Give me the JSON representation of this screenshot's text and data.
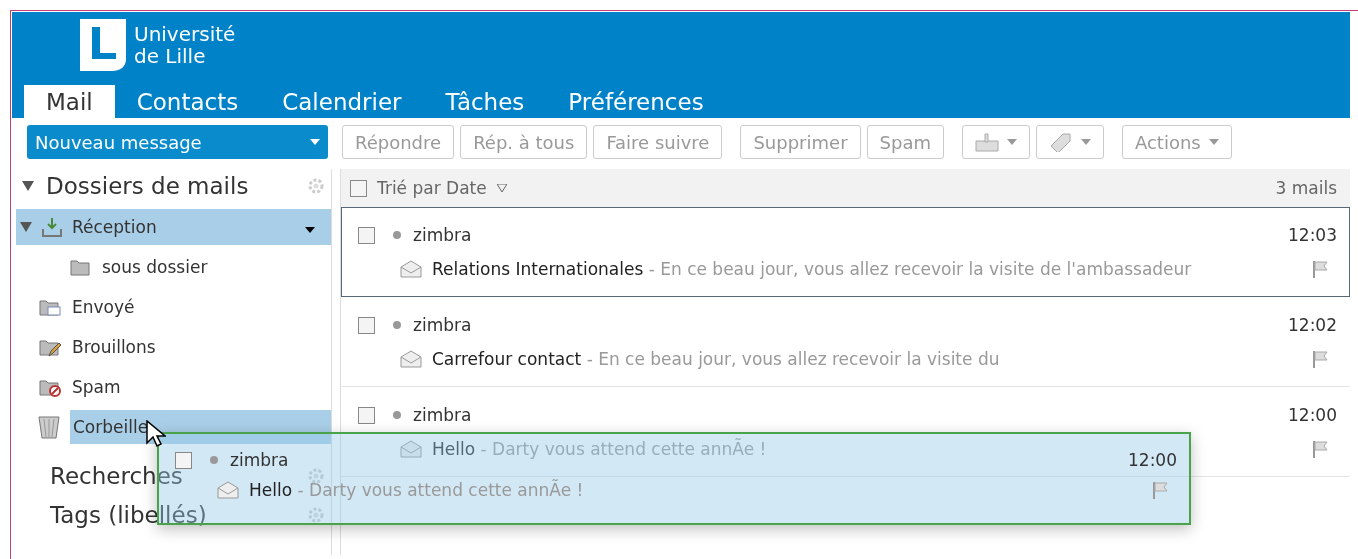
{
  "header": {
    "logo_lines": [
      "Université",
      "de Lille"
    ]
  },
  "tabs": [
    {
      "label": "Mail",
      "selected": true
    },
    {
      "label": "Contacts",
      "selected": false
    },
    {
      "label": "Calendrier",
      "selected": false
    },
    {
      "label": "Tâches",
      "selected": false
    },
    {
      "label": "Préférences",
      "selected": false
    }
  ],
  "new_message": {
    "label": "Nouveau message"
  },
  "toolbar": [
    {
      "kind": "text",
      "label": "Répondre",
      "disabled": true
    },
    {
      "kind": "text",
      "label": "Rép. à tous",
      "disabled": true
    },
    {
      "kind": "text",
      "label": "Faire suivre",
      "disabled": true
    },
    {
      "kind": "text",
      "label": "Supprimer",
      "disabled": true
    },
    {
      "kind": "text",
      "label": "Spam",
      "disabled": true
    },
    {
      "kind": "move",
      "disabled": true
    },
    {
      "kind": "tag",
      "disabled": true
    },
    {
      "kind": "menu",
      "label": "Actions",
      "disabled": true
    }
  ],
  "sidebar": {
    "title": "Dossiers de mails",
    "expanded": true,
    "folders": [
      {
        "kind": "inbox",
        "label": "Réception",
        "selected": true,
        "drop_target": false,
        "expanded": true,
        "children": [
          {
            "kind": "folder",
            "label": "sous dossier",
            "selected": false,
            "drop_target": false
          }
        ]
      },
      {
        "kind": "sent",
        "label": "Envoyé",
        "selected": false,
        "drop_target": false
      },
      {
        "kind": "drafts",
        "label": "Brouillons",
        "selected": false,
        "drop_target": false
      },
      {
        "kind": "spam",
        "label": "Spam",
        "selected": false,
        "drop_target": false
      },
      {
        "kind": "trash",
        "label": "Corbeille",
        "selected": false,
        "drop_target": true
      }
    ],
    "sections": [
      {
        "title": "Recherches"
      },
      {
        "title": "Tags (libellés)"
      }
    ]
  },
  "mail_list": {
    "select_all_checked": false,
    "sort_label": "Trié par Date",
    "count": "3 mails",
    "messages": [
      {
        "sender": "zimbra",
        "time": "12:03",
        "subject": "Relations Internationales",
        "preview": " - En ce beau jour, vous allez recevoir la visite de l'ambassadeur",
        "selected": true,
        "checked": false
      },
      {
        "sender": "zimbra",
        "time": "12:02",
        "subject": "Carrefour contact",
        "preview": " - En ce beau jour, vous allez recevoir la visite du",
        "selected": false,
        "checked": false
      },
      {
        "sender": "zimbra",
        "time": "12:00",
        "subject": "Hello",
        "preview": " - Darty vous attend cette annÃe !",
        "selected": false,
        "checked": false
      }
    ]
  },
  "drag_preview": {
    "checked": false,
    "sender": "zimbra",
    "time": "12:00",
    "subject": "Hello",
    "preview": " - Darty vous attend cette annÃe !"
  }
}
